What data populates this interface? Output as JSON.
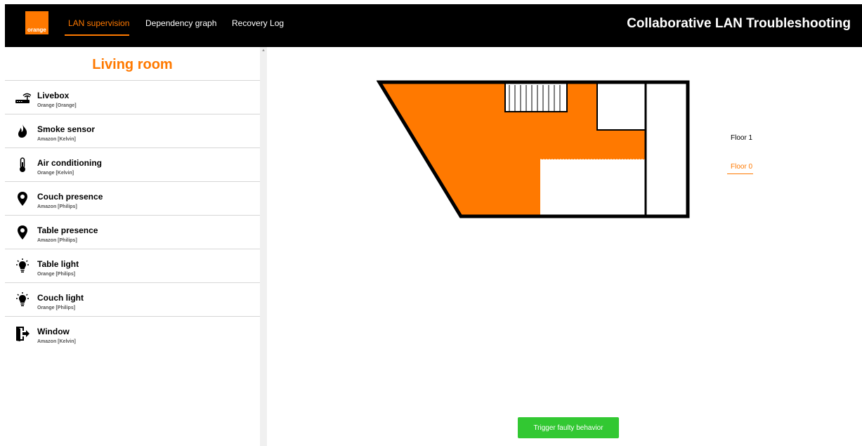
{
  "header": {
    "logo_text": "orange",
    "nav": [
      {
        "label": "LAN supervision",
        "active": true
      },
      {
        "label": "Dependency graph",
        "active": false
      },
      {
        "label": "Recovery Log",
        "active": false
      }
    ],
    "app_title": "Collaborative LAN Troubleshooting"
  },
  "sidebar": {
    "room_title": "Living room",
    "devices": [
      {
        "name": "Livebox",
        "vendor": "Orange [Orange]",
        "icon": "router-icon"
      },
      {
        "name": "Smoke sensor",
        "vendor": "Amazon [Kelvin]",
        "icon": "flame-icon"
      },
      {
        "name": "Air conditioning",
        "vendor": "Orange [Kelvin]",
        "icon": "thermometer-icon"
      },
      {
        "name": "Couch presence",
        "vendor": "Amazon [Philips]",
        "icon": "map-marker-icon"
      },
      {
        "name": "Table presence",
        "vendor": "Amazon [Philips]",
        "icon": "map-marker-icon"
      },
      {
        "name": "Table light",
        "vendor": "Orange [Philips]",
        "icon": "lightbulb-icon"
      },
      {
        "name": "Couch light",
        "vendor": "Orange [Philips]",
        "icon": "lightbulb-icon"
      },
      {
        "name": "Window",
        "vendor": "Amazon [Kelvin]",
        "icon": "door-exit-icon"
      }
    ]
  },
  "main": {
    "floors": [
      {
        "label": "Floor 1",
        "active": false
      },
      {
        "label": "Floor 0",
        "active": true
      }
    ],
    "trigger_button": "Trigger faulty behavior"
  },
  "colors": {
    "accent": "#ff7900",
    "header_bg": "#000000",
    "button_green": "#32c832"
  }
}
